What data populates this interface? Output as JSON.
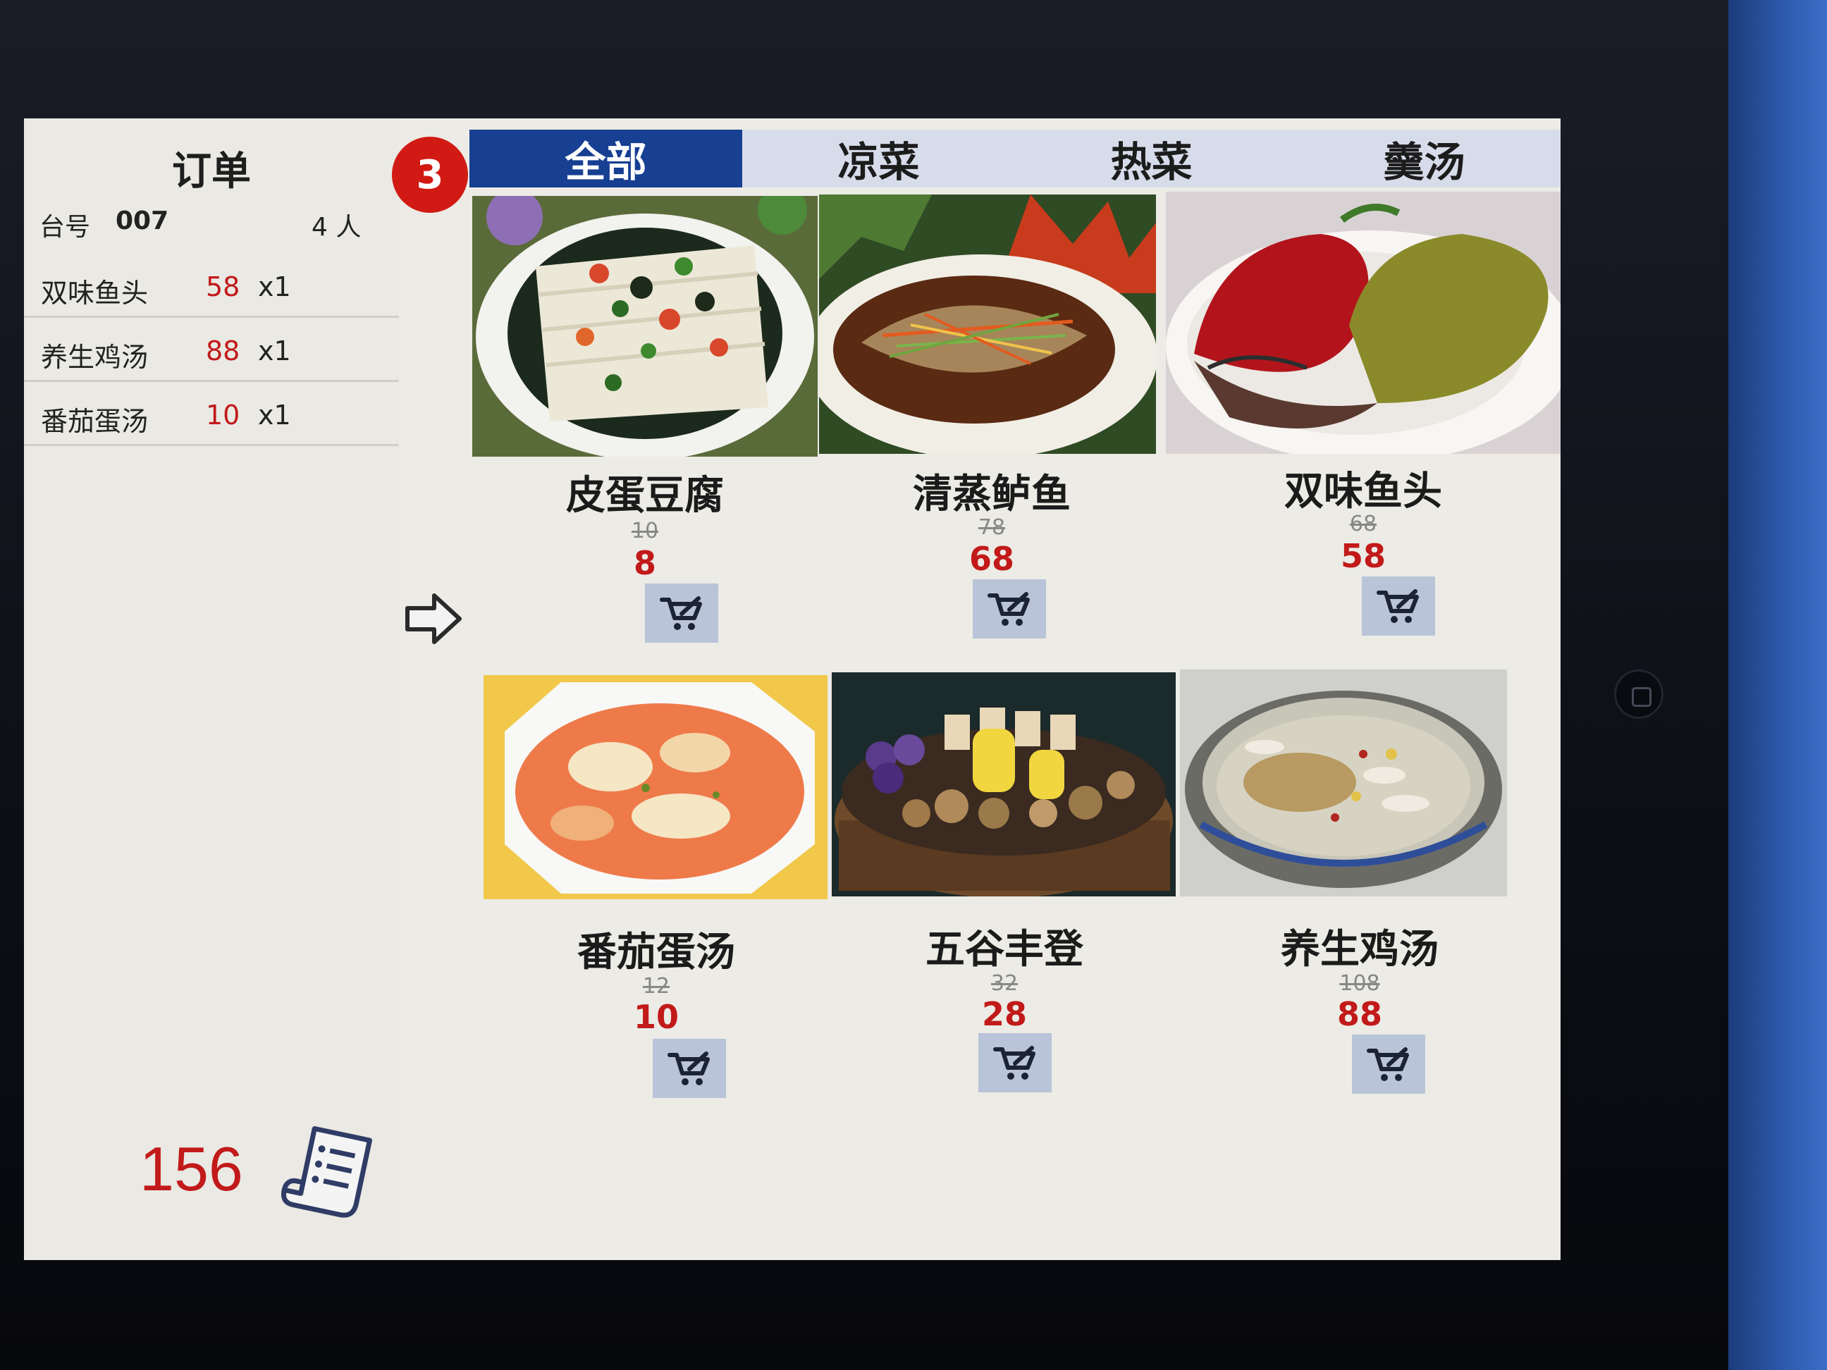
{
  "order": {
    "title": "订单",
    "table_label": "台号",
    "table_number": "007",
    "guests": "4 人",
    "items": [
      {
        "name": "双味鱼头",
        "price": "58",
        "qty": "x1"
      },
      {
        "name": "养生鸡汤",
        "price": "88",
        "qty": "x1"
      },
      {
        "name": "番茄蛋汤",
        "price": "10",
        "qty": "x1"
      }
    ],
    "total": "156"
  },
  "cart_count": "3",
  "tabs": [
    {
      "label": "全部",
      "active": true
    },
    {
      "label": "凉菜",
      "active": false
    },
    {
      "label": "热菜",
      "active": false
    },
    {
      "label": "羹汤",
      "active": false
    }
  ],
  "dishes": [
    {
      "name": "皮蛋豆腐",
      "old_price": "10",
      "price": "8"
    },
    {
      "name": "清蒸鲈鱼",
      "old_price": "78",
      "price": "68"
    },
    {
      "name": "双味鱼头",
      "old_price": "68",
      "price": "58"
    },
    {
      "name": "番茄蛋汤",
      "old_price": "12",
      "price": "10"
    },
    {
      "name": "五谷丰登",
      "old_price": "32",
      "price": "28"
    },
    {
      "name": "养生鸡汤",
      "old_price": "108",
      "price": "88"
    }
  ],
  "icons": {
    "cart": "shopping-cart-icon",
    "receipt": "receipt-icon",
    "arrow": "arrow-right-icon"
  },
  "colors": {
    "accent_red": "#c21a1a",
    "active_tab": "#173f92",
    "tab_bar": "#d7dcea",
    "cart_button": "#b9c4d9"
  }
}
